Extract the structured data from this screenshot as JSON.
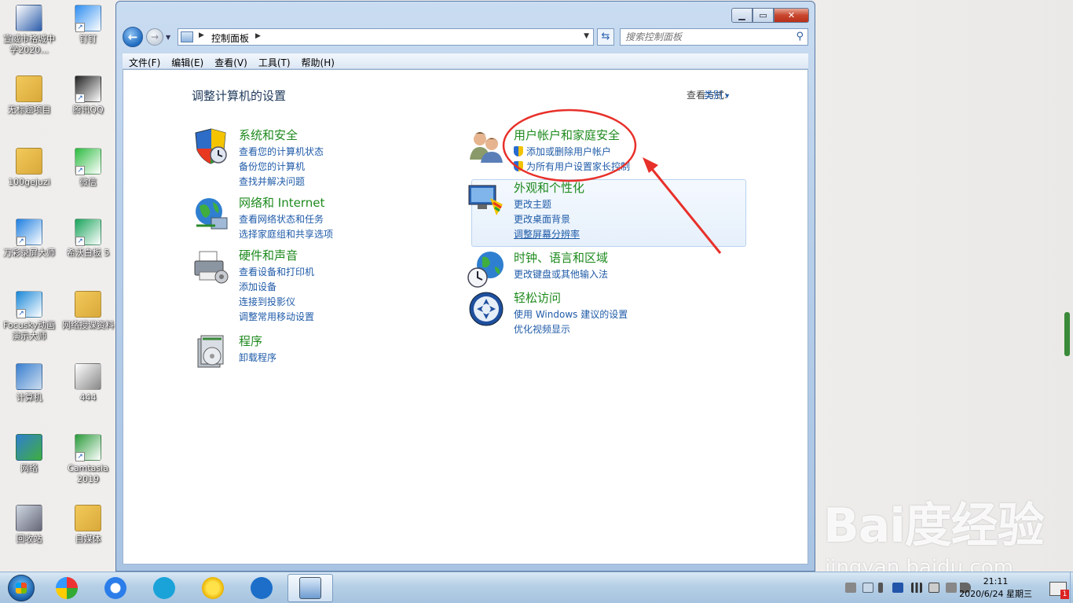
{
  "desktop": {
    "icons": [
      {
        "label": "宣威市格城中学2020...",
        "icon": "word-doc-icon"
      },
      {
        "label": "钉钉",
        "icon": "dingtalk-icon"
      },
      {
        "label": "无标题项目",
        "icon": "folder-icon"
      },
      {
        "label": "腾讯QQ",
        "icon": "qq-icon"
      },
      {
        "label": "100gejuzi",
        "icon": "folder-icon"
      },
      {
        "label": "微信",
        "icon": "wechat-icon"
      },
      {
        "label": "万彩录屏大师",
        "icon": "screen-recorder-icon"
      },
      {
        "label": "希沃白板 5",
        "icon": "seewo-icon"
      },
      {
        "label": "Focusky动画演示大师",
        "icon": "focusky-icon"
      },
      {
        "label": "网络授课资料",
        "icon": "folder-icon"
      },
      {
        "label": "计算机",
        "icon": "computer-icon"
      },
      {
        "label": "444",
        "icon": "file-icon"
      },
      {
        "label": "网络",
        "icon": "network-icon"
      },
      {
        "label": "Camtasia 2019",
        "icon": "camtasia-icon"
      },
      {
        "label": "回收站",
        "icon": "recycle-bin-icon"
      },
      {
        "label": "自媒体",
        "icon": "folder-icon"
      }
    ]
  },
  "window": {
    "address_crumb": "控制面板",
    "search_placeholder": "搜索控制面板",
    "menu": [
      "文件(F)",
      "编辑(E)",
      "查看(V)",
      "工具(T)",
      "帮助(H)"
    ],
    "heading": "调整计算机的设置",
    "view_by_label": "查看方式:",
    "view_by_value": "类别",
    "categories": [
      {
        "title": "系统和安全",
        "icon": "security-shield-icon",
        "links": [
          "查看您的计算机状态",
          "备份您的计算机",
          "查找并解决问题"
        ]
      },
      {
        "title": "网络和 Internet",
        "icon": "network-globe-icon",
        "links": [
          "查看网络状态和任务",
          "选择家庭组和共享选项"
        ]
      },
      {
        "title": "硬件和声音",
        "icon": "printer-icon",
        "links": [
          "查看设备和打印机",
          "添加设备",
          "连接到投影仪",
          "调整常用移动设置"
        ]
      },
      {
        "title": "程序",
        "icon": "programs-icon",
        "links": [
          "卸载程序"
        ]
      },
      {
        "title": "用户帐户和家庭安全",
        "icon": "users-icon",
        "links": [
          "添加或删除用户帐户",
          "为所有用户设置家长控制"
        ]
      },
      {
        "title": "外观和个性化",
        "icon": "monitor-paint-icon",
        "links": [
          "更改主题",
          "更改桌面背景",
          "调整屏幕分辨率"
        ]
      },
      {
        "title": "时钟、语言和区域",
        "icon": "clock-globe-icon",
        "links": [
          "更改键盘或其他输入法"
        ]
      },
      {
        "title": "轻松访问",
        "icon": "ease-of-access-icon",
        "links": [
          "使用 Windows 建议的设置",
          "优化视频显示"
        ]
      }
    ]
  },
  "taskbar": {
    "time": "21:11",
    "date": "2020/6/24 星期三",
    "notification_count": "1"
  },
  "watermark": {
    "logo": "Bai度经验",
    "url": "jingyan.baidu.com"
  },
  "colors": {
    "category_title": "#1e8a1e",
    "link": "#1f5ba8",
    "annotation": "#e8302a"
  }
}
